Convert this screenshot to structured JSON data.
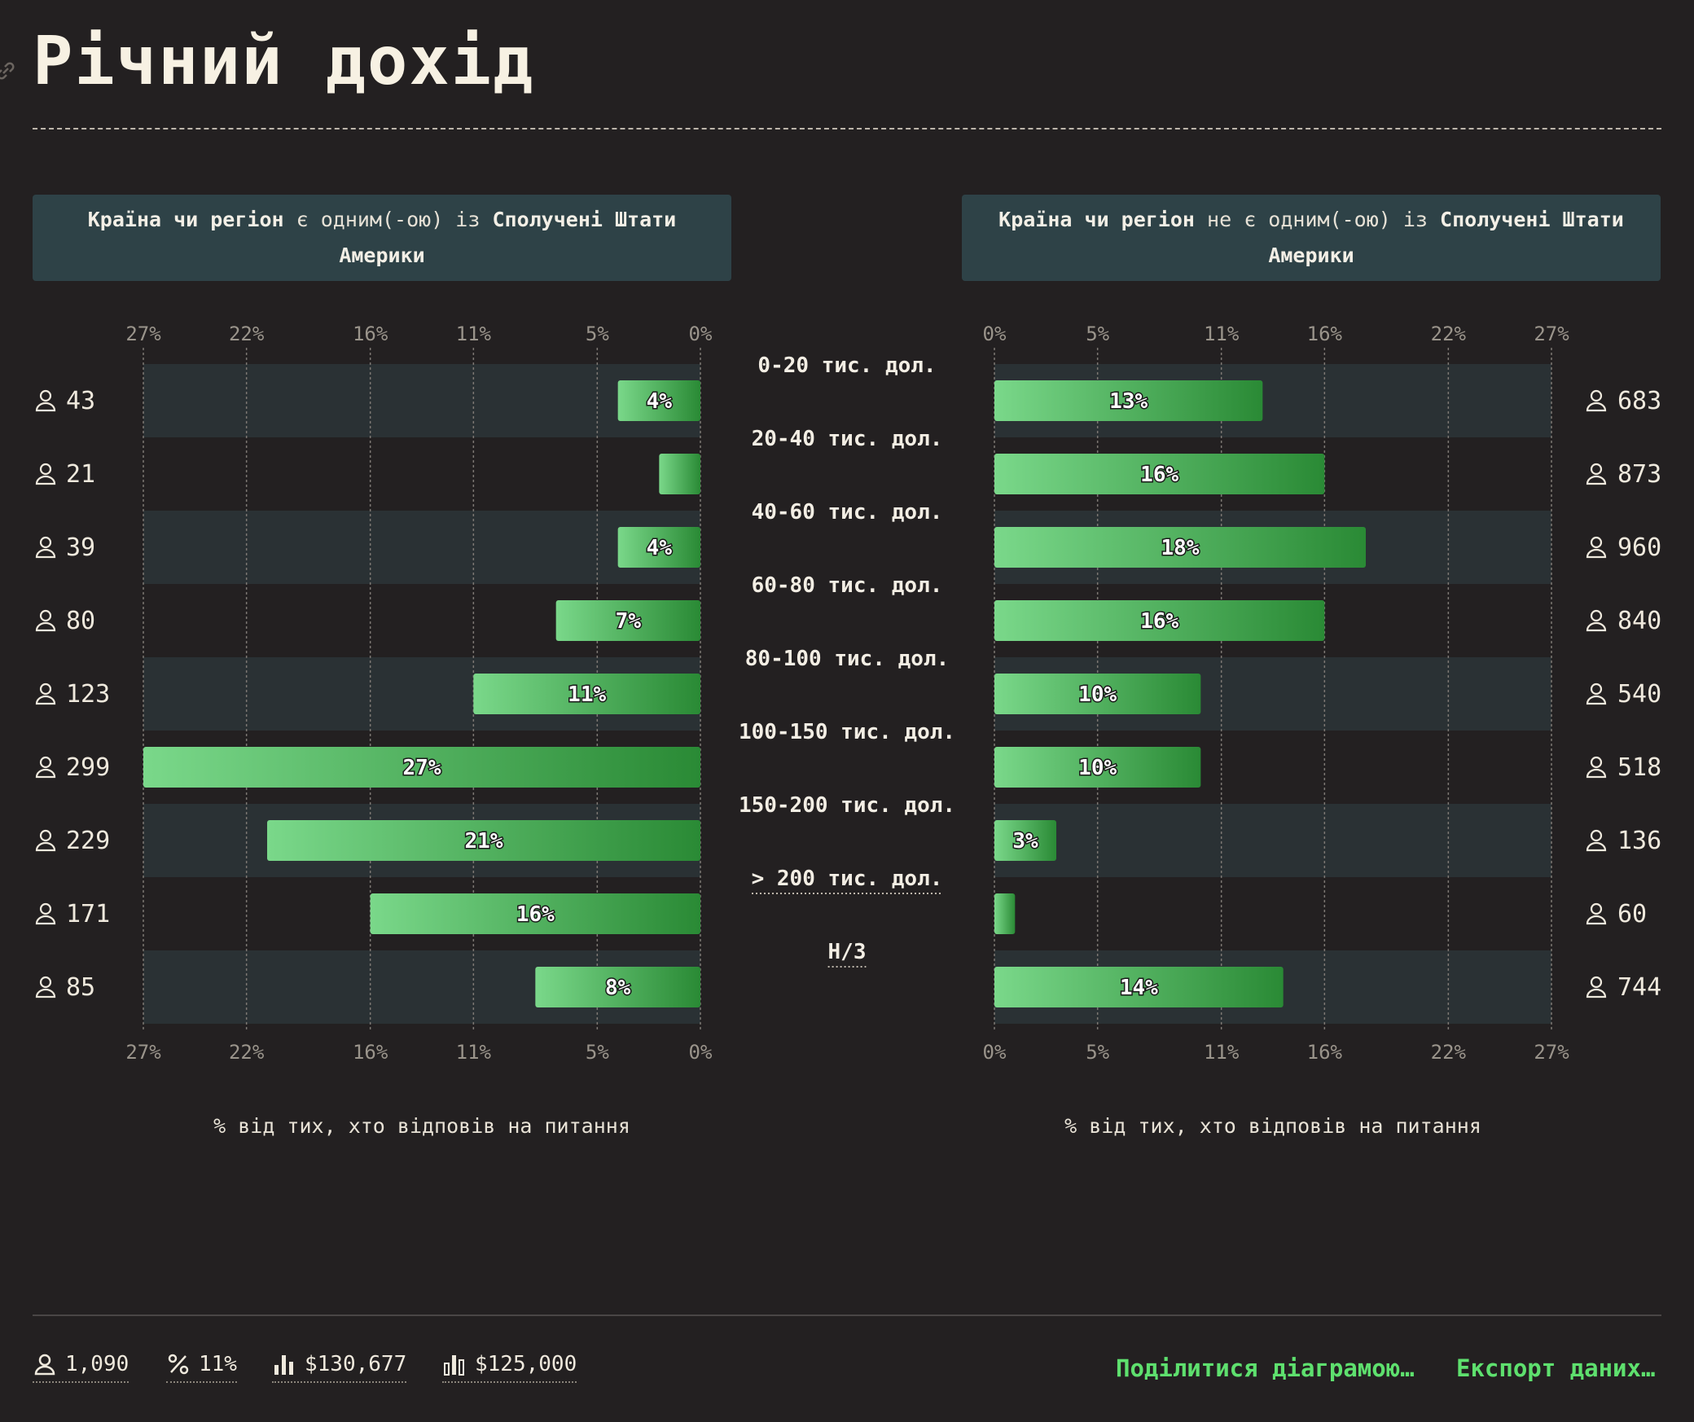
{
  "title": "Річний дохід",
  "panels": {
    "left": {
      "h1": "Країна чи регіон",
      "op": "є одним(-ою) із",
      "h2": "Сполучені Штати Америки"
    },
    "right": {
      "h1": "Країна чи регіон",
      "op": "не є одним(-ою) із",
      "h2": "Сполучені Штати Америки"
    }
  },
  "axis_label": "% від тих, хто відповів на питання",
  "footer": {
    "respondents": "1,090",
    "percent": "11%",
    "mean": "$130,677",
    "median": "$125,000",
    "share_label": "Поділитися діаграмою…",
    "export_label": "Експорт даних…"
  },
  "colors": {
    "bar_light": "#7ad88a",
    "bar_dark": "#2a8a35",
    "band": "#2a3134",
    "accent": "#5ee06e"
  },
  "icons": {
    "count": "person-icon",
    "percent": "percent-icon",
    "mean": "bar-chart-icon",
    "median": "bar-chart-median-icon",
    "link": "link-icon"
  },
  "chart_data": {
    "type": "bar",
    "orientation": "horizontal-diverging",
    "categories": [
      "0-20 тис. дол.",
      "20-40 тис. дол.",
      "40-60 тис. дол.",
      "60-80 тис. дол.",
      "80-100 тис. дол.",
      "100-150 тис. дол.",
      "150-200 тис. дол.",
      "> 200 тис. дол.",
      "Н/З"
    ],
    "underlined_categories": [
      "> 200 тис. дол.",
      "Н/З"
    ],
    "xlim": [
      0,
      27
    ],
    "ticks": [
      "0%",
      "5%",
      "11%",
      "16%",
      "22%",
      "27%"
    ],
    "tick_values": [
      0,
      5,
      11,
      16,
      22,
      27
    ],
    "xlabel": "% від тих, хто відповів на питання",
    "series": [
      {
        "values": [
          4,
          2,
          4,
          7,
          11,
          27,
          21,
          16,
          8
        ],
        "labels": [
          "4%",
          "",
          "4%",
          "7%",
          "11%",
          "27%",
          "21%",
          "16%",
          "8%"
        ],
        "counts": [
          "43",
          "21",
          "39",
          "80",
          "123",
          "299",
          "229",
          "171",
          "85"
        ]
      },
      {
        "values": [
          13,
          16,
          18,
          16,
          10,
          10,
          3,
          1,
          14
        ],
        "labels": [
          "13%",
          "16%",
          "18%",
          "16%",
          "10%",
          "10%",
          "3%",
          "",
          "14%"
        ],
        "counts": [
          "683",
          "873",
          "960",
          "840",
          "540",
          "518",
          "136",
          "60",
          "744"
        ]
      }
    ]
  }
}
